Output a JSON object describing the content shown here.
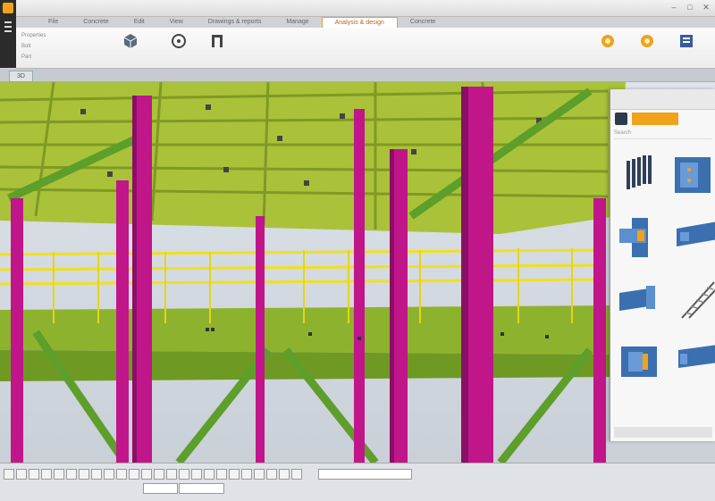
{
  "window": {
    "title": "",
    "controls": [
      "–",
      "□",
      "✕"
    ]
  },
  "ribbon": {
    "tabs": [
      {
        "label": "File"
      },
      {
        "label": "Concrete"
      },
      {
        "label": "Edit"
      },
      {
        "label": "View"
      },
      {
        "label": "Drawings & reports"
      },
      {
        "label": "Manage"
      },
      {
        "label": "Analysis & design"
      },
      {
        "label": "Concrete"
      }
    ],
    "buttons": [
      {
        "label": "",
        "icon": "cube-icon"
      },
      {
        "label": "",
        "icon": "layout-icon"
      },
      {
        "label": "",
        "icon": "connect-icon"
      },
      {
        "label": "",
        "icon": "gear-icon"
      },
      {
        "label": "",
        "icon": "gear-icon"
      },
      {
        "label": "",
        "icon": "report-icon"
      }
    ],
    "small_items": [
      "Properties",
      "Bolt",
      "Part",
      "",
      "",
      ""
    ]
  },
  "view": {
    "tab_label": "3D"
  },
  "panel": {
    "tab_label": "",
    "search_placeholder": "Search",
    "category": "",
    "items": [
      {
        "label": "",
        "icon": "plates-icon"
      },
      {
        "label": "",
        "icon": "connection-icon"
      },
      {
        "label": "",
        "icon": "connection-icon"
      },
      {
        "label": "",
        "icon": "connection-icon"
      },
      {
        "label": "",
        "icon": "connection-icon"
      },
      {
        "label": "",
        "icon": "stair-icon"
      },
      {
        "label": "",
        "icon": "connection-icon"
      },
      {
        "label": "",
        "icon": "connection-icon"
      }
    ],
    "footer": ""
  },
  "statusbar": {
    "field1": "",
    "field2": "",
    "field3": ""
  },
  "colors": {
    "beam_green": "#a9c23a",
    "column_magenta": "#c0168a",
    "railing_yellow": "#f0e020",
    "brace_green": "#5e9e2a",
    "accent_orange": "#f0a21a",
    "sky": "#cfd7df"
  }
}
